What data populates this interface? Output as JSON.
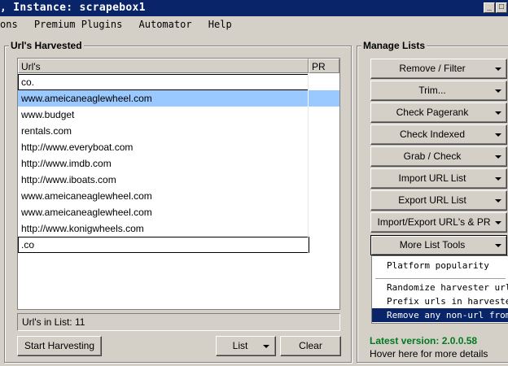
{
  "window": {
    "title": ", Instance: scrapebox1",
    "min_glyph": "_",
    "max_glyph": "□"
  },
  "menu": [
    "ons",
    "Premium Plugins",
    "Automator",
    "Help"
  ],
  "harvested": {
    "group_label": "Url's Harvested",
    "columns": [
      "Url's",
      "PR"
    ],
    "rows": [
      "co.",
      "www.ameicaneaglewheel.com",
      "www.budget",
      "rentals.com",
      "http://www.everyboat.com",
      "http://www.imdb.com",
      "http://www.iboats.com",
      "www.ameicaneaglewheel.com",
      "www.ameicaneaglewheel.com",
      "http://www.konigwheels.com",
      ".co"
    ],
    "selected_row": 1,
    "status": "Url's in List: 11",
    "start_button": "Start Harvesting",
    "list_button": "List",
    "clear_button": "Clear"
  },
  "manage": {
    "group_label": "Manage Lists",
    "buttons": [
      "Remove / Filter",
      "Trim...",
      "Check Pagerank",
      "Check Indexed",
      "Grab / Check",
      "Import URL List",
      "Export URL List",
      "Import/Export URL's & PR",
      "More List Tools"
    ],
    "menu_items": [
      "Platform popularity",
      "Randomize harvester urls",
      "Prefix urls in harvester",
      "Remove any non-url from h"
    ],
    "highlighted_item": 3
  },
  "footer": {
    "latest_version": "Latest version:  2.0.0.58",
    "hover_text": "Hover here for more details"
  }
}
